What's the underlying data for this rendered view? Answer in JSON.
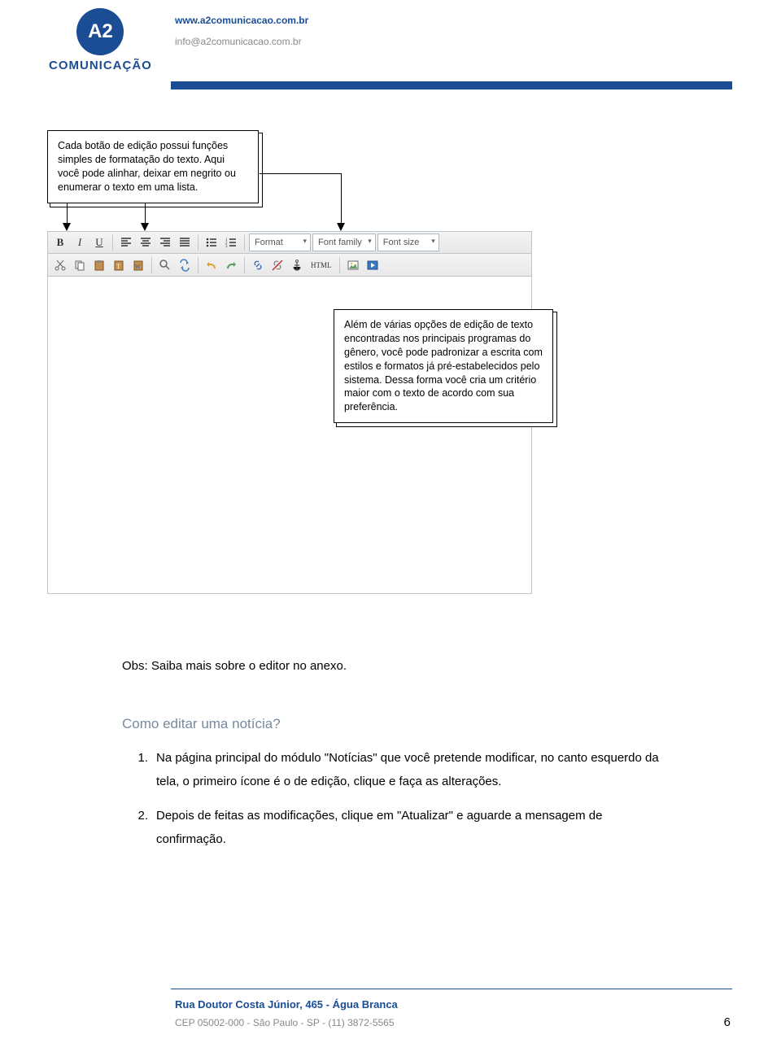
{
  "header": {
    "logo_text": "A2",
    "logo_label": "COMUNICAÇÃO",
    "url": "www.a2comunicacao.com.br",
    "email": "info@a2comunicacao.com.br"
  },
  "callouts": {
    "c1": "Cada botão de edição possui funções simples de formatação do texto. Aqui você pode alinhar, deixar em negrito ou enumerar o texto em uma lista.",
    "c2": "Além de várias opções de edição de texto encontradas nos principais programas do gênero, você pode padronizar a escrita com estilos e formatos já pré-estabelecidos pelo sistema. Dessa forma você cria um critério maior com o texto de acordo com sua preferência."
  },
  "toolbar": {
    "bold": "B",
    "italic": "I",
    "underline": "U",
    "format": "Format",
    "font_family": "Font family",
    "font_size": "Font size",
    "html": "HTML"
  },
  "content": {
    "obs": "Obs: Saiba mais sobre o editor no anexo.",
    "heading": "Como editar uma notícia?",
    "item1_num": "1.",
    "item1_text": "Na página principal do módulo \"Notícias\" que você pretende modificar, no canto esquerdo da tela, o primeiro ícone é o de edição, clique e faça as alterações.",
    "item2_num": "2.",
    "item2_text": "Depois de feitas as modificações, clique em \"Atualizar\" e aguarde a mensagem de confirmação."
  },
  "footer": {
    "addr1": "Rua Doutor Costa Júnior, 465 - Água Branca",
    "addr2": "CEP 05002-000 - São Paulo - SP - (11) 3872-5565",
    "page": "6"
  }
}
